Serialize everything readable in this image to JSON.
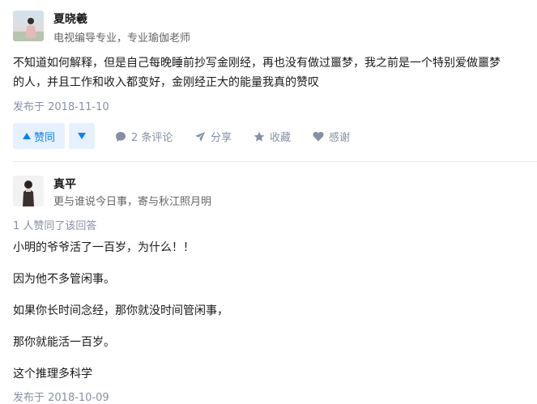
{
  "answers": [
    {
      "author": {
        "name": "夏晓羲",
        "headline": "电视编导专业，专业瑜伽老师"
      },
      "content_lines": [
        "不知道如何解释，但是自己每晚睡前抄写金刚经，再也没有做过噩梦，我之前是一个特别爱做噩梦",
        "的人，并且工作和收入都变好，金刚经正大的能量我真的赞叹"
      ],
      "date": "发布于 2018-11-10",
      "actions": {
        "vote_up": "赞同",
        "comments": "2 条评论",
        "share": "分享",
        "favorite": "收藏",
        "thanks": "感谢"
      }
    },
    {
      "author": {
        "name": "真平",
        "headline": "更与谁说今日事，寄与秋江照月明"
      },
      "vote_info": "1 人赞同了该回答",
      "paragraphs": [
        "小明的爷爷活了一百岁，为什么！！",
        "因为他不多管闲事。",
        "如果你长时间念经，那你就没时间管闲事，",
        "那你就能活一百岁。",
        "这个推理多科学"
      ],
      "date": "发布于 2018-10-09"
    }
  ],
  "colors": {
    "accent": "#0084ff",
    "accent_bg": "#e6f1ff",
    "meta": "#8590a6"
  }
}
